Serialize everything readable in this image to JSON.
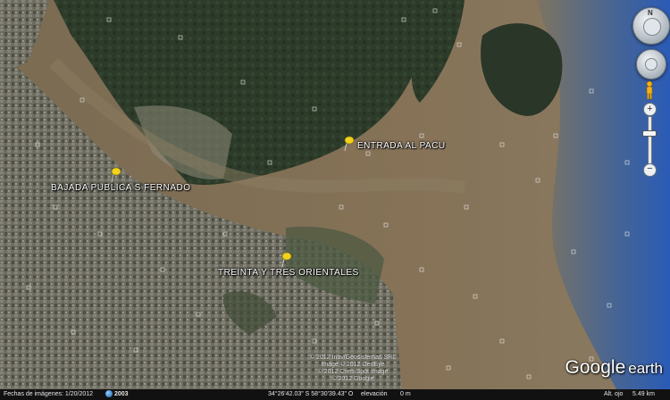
{
  "app": {
    "title": "Google Earth"
  },
  "placemarks": [
    {
      "label": "ENTRADA AL PACU",
      "icon": "yellow-pushpin-icon"
    },
    {
      "label": "BAJADA PUBLICA S FERNADO",
      "icon": "yellow-pushpin-icon"
    },
    {
      "label": "TREINTA Y TRES ORIENTALES",
      "icon": "yellow-pushpin-icon"
    }
  ],
  "navigation": {
    "look_label": "N",
    "zoom_in": "+",
    "zoom_out": "−",
    "zoom_level": 0.35,
    "icons": [
      "look-joystick-icon",
      "move-joystick-icon",
      "street-view-pegman-icon",
      "zoom-slider-icon"
    ]
  },
  "copyright": {
    "line1": "© 2012 Inav/Geosistemas SRL",
    "line2": "Image © 2012 GeoEye",
    "line3": "© 2012 Cnes/Spot Image",
    "line4": "© 2012 Google"
  },
  "logo": {
    "brand": "Google",
    "product": "earth"
  },
  "statusbar": {
    "imagery_date_label": "Fechas de imágenes: 1/20/2012",
    "year": "2003",
    "coords": "34°26'42.03\" S  58°30'39.43\" O",
    "elevation_label": "elevación",
    "elevation_value": "0 m",
    "eye_alt_label": "Alt. ojo",
    "eye_alt_value": "5.49 km"
  },
  "colors": {
    "river": "#7d6e57",
    "delta_vegetation": "#2c3a2a",
    "urban": "#6b6b5d",
    "ocean": "#2f5fb5",
    "pin": "#f2d21c"
  }
}
